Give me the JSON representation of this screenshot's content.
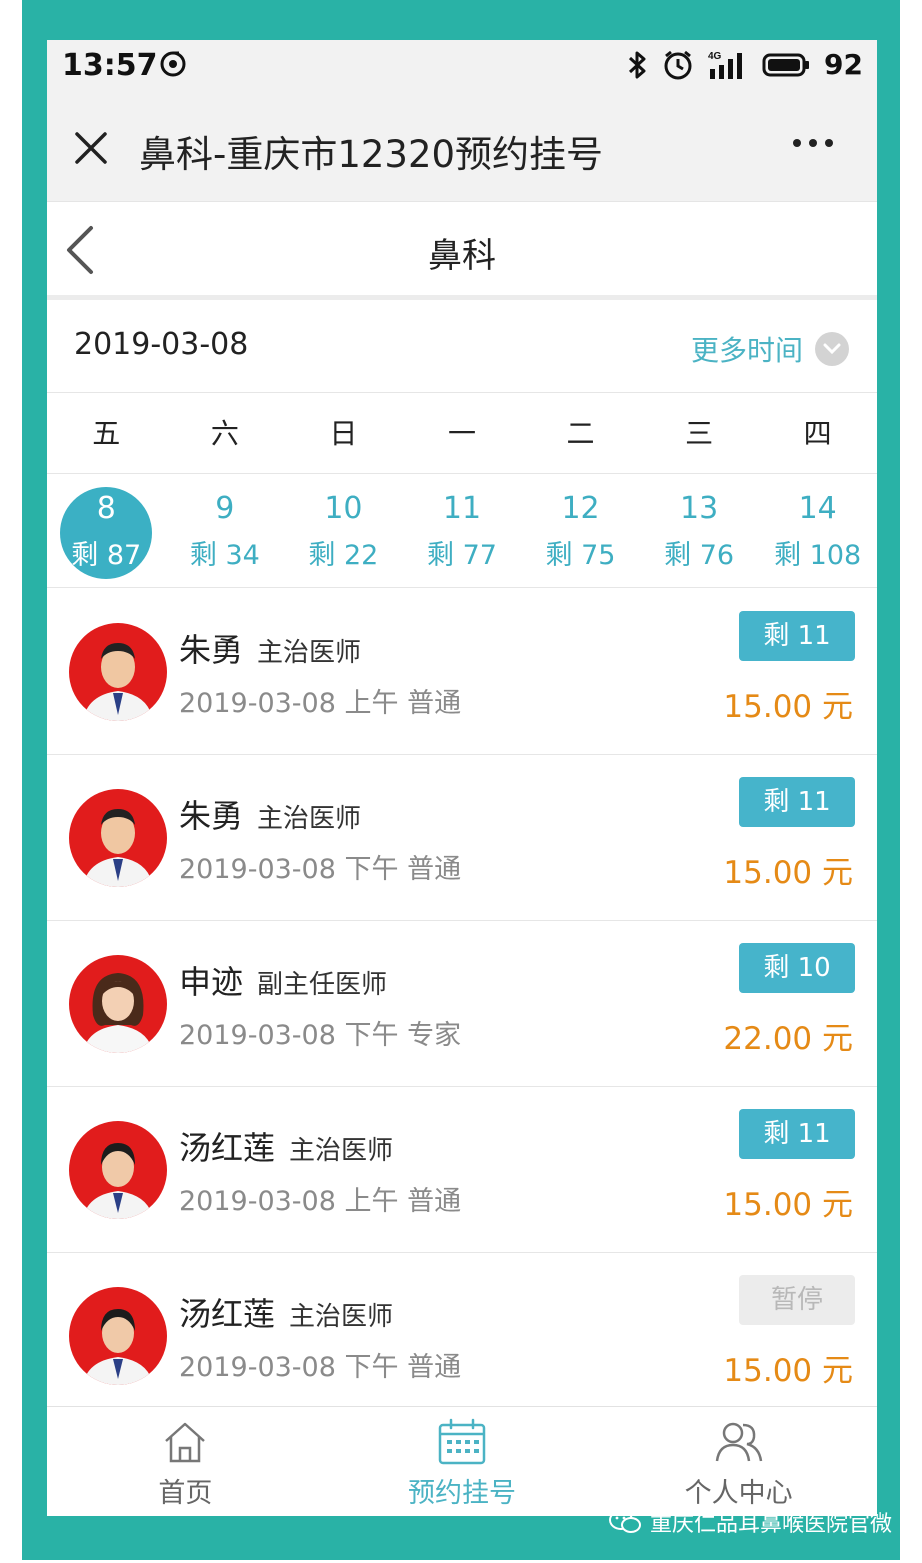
{
  "status_bar": {
    "time": "13:57",
    "battery": "92",
    "network": "4G"
  },
  "window": {
    "title": "鼻科-重庆市12320预约挂号"
  },
  "nav": {
    "title": "鼻科"
  },
  "date_selector": {
    "current_date": "2019-03-08",
    "more_time_label": "更多时间"
  },
  "weekdays": [
    "五",
    "六",
    "日",
    "一",
    "二",
    "三",
    "四"
  ],
  "days": [
    {
      "day": "8",
      "remain": "剩 87",
      "selected": true
    },
    {
      "day": "9",
      "remain": "剩 34"
    },
    {
      "day": "10",
      "remain": "剩 22"
    },
    {
      "day": "11",
      "remain": "剩 77"
    },
    {
      "day": "12",
      "remain": "剩 75"
    },
    {
      "day": "13",
      "remain": "剩 76"
    },
    {
      "day": "14",
      "remain": "剩 108"
    }
  ],
  "doctors": [
    {
      "name": "朱勇",
      "title": "主治医师",
      "info": "2019-03-08 上午   普通",
      "badge": "剩 11",
      "price": "15.00 元",
      "gender": "male"
    },
    {
      "name": "朱勇",
      "title": "主治医师",
      "info": "2019-03-08 下午   普通",
      "badge": "剩 11",
      "price": "15.00 元",
      "gender": "male"
    },
    {
      "name": "申迹",
      "title": "副主任医师",
      "info": "2019-03-08 下午   专家",
      "badge": "剩 10",
      "price": "22.00 元",
      "gender": "female"
    },
    {
      "name": "汤红莲",
      "title": "主治医师",
      "info": "2019-03-08 上午   普通",
      "badge": "剩 11",
      "price": "15.00 元",
      "gender": "female"
    },
    {
      "name": "汤红莲",
      "title": "主治医师",
      "info": "2019-03-08 下午   普通",
      "badge": "暂停",
      "price": "15.00 元",
      "gender": "female",
      "paused": true
    }
  ],
  "tabs": [
    {
      "label": "首页",
      "icon": "home-icon"
    },
    {
      "label": "预约挂号",
      "icon": "calendar-icon",
      "active": true
    },
    {
      "label": "个人中心",
      "icon": "users-icon"
    }
  ],
  "watermark": {
    "text": "重庆仁品耳鼻喉医院官微"
  },
  "colors": {
    "border_teal": "#29b2a6",
    "accent_blue": "#3bb0c4",
    "price_orange": "#e58a16",
    "avatar_red": "#e11c1c"
  }
}
